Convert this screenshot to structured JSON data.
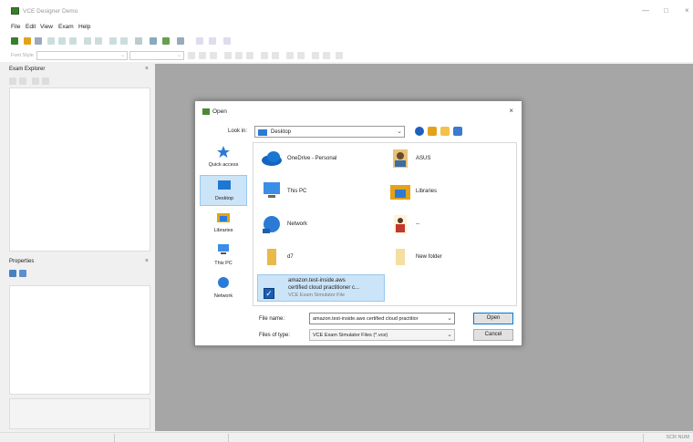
{
  "app": {
    "title": "VCE Designer Demo"
  },
  "window_controls": {
    "minimize": "—",
    "maximize": "□",
    "close": "×"
  },
  "menu": [
    "File",
    "Edit",
    "View",
    "Exam",
    "Help"
  ],
  "toolbar2": {
    "font_style_placeholder": "Font Style"
  },
  "exam_explorer": {
    "title": "Exam Explorer",
    "close": "×"
  },
  "properties": {
    "title": "Properties",
    "close": "×"
  },
  "statusbar": {
    "indicator": "SCR NUM"
  },
  "dialog": {
    "title": "Open",
    "close": "×",
    "look_in_label": "Look in:",
    "look_in_value": "Desktop",
    "places": [
      {
        "label": "Quick access",
        "icon": "star-icon"
      },
      {
        "label": "Desktop",
        "icon": "desktop-icon"
      },
      {
        "label": "Libraries",
        "icon": "libraries-icon"
      },
      {
        "label": "This PC",
        "icon": "computer-icon"
      },
      {
        "label": "Network",
        "icon": "network-icon"
      }
    ],
    "files": [
      {
        "label": "OneDrive - Personal",
        "icon": "cloud-icon"
      },
      {
        "label": "ASUS",
        "icon": "user-icon"
      },
      {
        "label": "This PC",
        "icon": "computer-icon"
      },
      {
        "label": "Libraries",
        "icon": "libraries-icon"
      },
      {
        "label": "Network",
        "icon": "network-icon"
      },
      {
        "label": "--",
        "icon": "user-icon"
      },
      {
        "label": "d7",
        "icon": "folder-icon"
      },
      {
        "label": "New folder",
        "icon": "folder-icon"
      }
    ],
    "selected_file": {
      "line1": "amazon.test-inside.aws",
      "line2": "certified cloud practitioner c...",
      "line3": "VCE Exam Simulator File"
    },
    "file_name_label": "File name:",
    "file_name_value": "amazon.test-inside.aws certified cloud practitior",
    "file_type_label": "Files of type:",
    "file_type_value": "VCE Exam Simulator Files (*.vce)",
    "open_button": "Open",
    "cancel_button": "Cancel"
  },
  "colors": {
    "workspace": "#a6a6a6",
    "accent": "#0078d7",
    "selection": "#cce4f7"
  }
}
